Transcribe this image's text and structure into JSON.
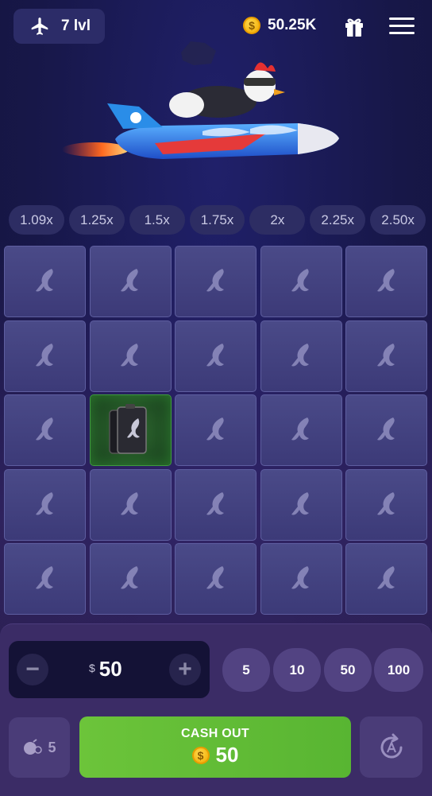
{
  "header": {
    "level_label": "7 lvl",
    "balance": "50.25K",
    "coin_symbol": "$"
  },
  "multipliers": [
    "1.09x",
    "1.25x",
    "1.5x",
    "1.75x",
    "2x",
    "2.25x",
    "2.50x"
  ],
  "grid": {
    "rows": 5,
    "cols": 5,
    "revealed": [
      {
        "row": 2,
        "col": 1,
        "item": "fuel-canister"
      }
    ]
  },
  "bet": {
    "currency": "$",
    "amount": "50",
    "minus": "−",
    "plus": "+",
    "quick_amounts": [
      "5",
      "10",
      "50",
      "100"
    ]
  },
  "mines": {
    "count": "5"
  },
  "cashout": {
    "label": "CASH OUT",
    "amount": "50",
    "coin_symbol": "$"
  },
  "colors": {
    "background": "#1a1a4e",
    "cell": "#3c3a78",
    "found_cell": "#2f6b30",
    "cashout": "#6cc43a",
    "panel": "#3b2c66"
  }
}
